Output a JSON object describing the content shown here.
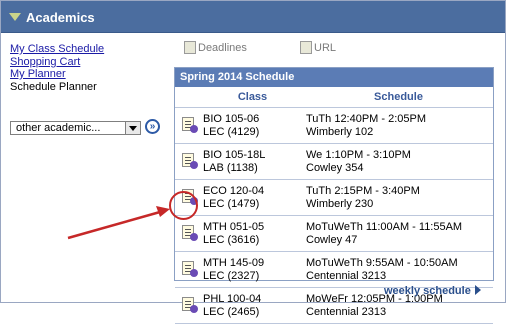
{
  "header": {
    "title": "Academics"
  },
  "links": {
    "my_class_schedule": "My Class Schedule",
    "shopping_cart": "Shopping Cart",
    "my_planner": "My Planner",
    "schedule_planner": "Schedule Planner"
  },
  "dropdown": {
    "value": "other academic..."
  },
  "tabs": {
    "deadlines": "Deadlines",
    "url": "URL"
  },
  "schedule": {
    "title": "Spring 2014 Schedule",
    "col_class": "Class",
    "col_schedule": "Schedule",
    "rows": [
      {
        "c1": "BIO 105-06",
        "c2": "LEC (4129)",
        "s1": "TuTh 12:40PM - 2:05PM",
        "s2": "Wimberly 102"
      },
      {
        "c1": "BIO 105-18L",
        "c2": "LAB (1138)",
        "s1": "We 1:10PM - 3:10PM",
        "s2": "Cowley 354"
      },
      {
        "c1": "ECO 120-04",
        "c2": "LEC (1479)",
        "s1": "TuTh 2:15PM - 3:40PM",
        "s2": "Wimberly 230"
      },
      {
        "c1": "MTH 051-05",
        "c2": "LEC (3616)",
        "s1": "MoTuWeTh 11:00AM - 11:55AM",
        "s2": "Cowley 47"
      },
      {
        "c1": "MTH 145-09",
        "c2": "LEC (2327)",
        "s1": "MoTuWeTh 9:55AM - 10:50AM",
        "s2": "Centennial 3213"
      },
      {
        "c1": "PHL 100-04",
        "c2": "LEC (2465)",
        "s1": "MoWeFr 12:05PM - 1:00PM",
        "s2": "Centennial 2313"
      }
    ]
  },
  "weekly_link": "weekly schedule",
  "colors": {
    "header": "#4b6d9f",
    "panel_header": "#5b7cb5",
    "annotation": "#c62828"
  },
  "icons": {
    "collapse": "triangle-down-icon",
    "go": "double-chevron-right-icon",
    "row": "class-details-icon"
  }
}
